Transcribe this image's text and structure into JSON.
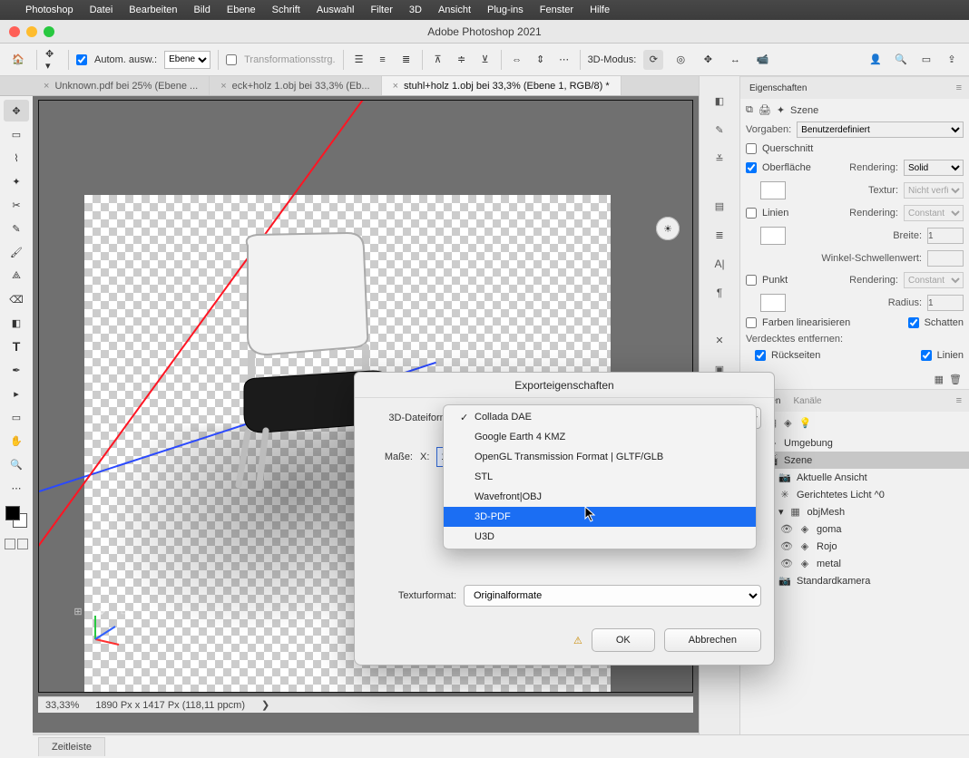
{
  "menubar": {
    "app": "Photoshop",
    "items": [
      "Datei",
      "Bearbeiten",
      "Bild",
      "Ebene",
      "Schrift",
      "Auswahl",
      "Filter",
      "3D",
      "Ansicht",
      "Plug-ins",
      "Fenster",
      "Hilfe"
    ]
  },
  "window": {
    "title": "Adobe Photoshop 2021"
  },
  "options": {
    "auto_select": "Autom. ausw.:",
    "layer_select": "Ebene",
    "transform_hint": "Transformationsstrg.",
    "mode_label": "3D-Modus:"
  },
  "tabs": [
    {
      "label": "Unknown.pdf bei 25% (Ebene ...",
      "active": false
    },
    {
      "label": "eck+holz 1.obj bei 33,3% (Eb...",
      "active": false
    },
    {
      "label": "stuhl+holz 1.obj bei 33,3% (Ebene 1, RGB/8) *",
      "active": true
    }
  ],
  "status": {
    "zoom": "33,33%",
    "dims": "1890 Px x 1417 Px (118,11 ppcm)"
  },
  "properties": {
    "title": "Eigenschaften",
    "scene_label": "Szene",
    "vorgaben_label": "Vorgaben:",
    "vorgaben_value": "Benutzerdefiniert",
    "querschnitt": "Querschnitt",
    "oberflache": "Oberfläche",
    "rendering": "Rendering:",
    "rendering_value": "Solid",
    "textur": "Textur:",
    "textur_value": "Nicht verfü...",
    "linien": "Linien",
    "linien_render": "Constant",
    "breite": "Breite:",
    "breite_value": "1",
    "winkel": "Winkel-Schwellenwert:",
    "punkt": "Punkt",
    "punkt_render": "Constant",
    "radius": "Radius:",
    "radius_value": "1",
    "linearisieren": "Farben linearisieren",
    "schatten": "Schatten",
    "verdeckt": "Verdecktes entfernen:",
    "ruckseiten": "Rückseiten",
    "linien2": "Linien"
  },
  "layers_panel": {
    "tabs": [
      "Ebenen",
      "Kanäle"
    ],
    "items": [
      {
        "label": "Umgebung",
        "icon": "◇",
        "indent": 0
      },
      {
        "label": "Szene",
        "icon": "🎬",
        "indent": 0,
        "selected": true
      },
      {
        "label": "Aktuelle Ansicht",
        "icon": "📷",
        "indent": 1
      },
      {
        "label": "Gerichtetes Licht ^0",
        "icon": "✳",
        "indent": 1
      },
      {
        "label": "objMesh",
        "icon": "▦",
        "indent": 1,
        "eye": true,
        "caret": true
      },
      {
        "label": "goma",
        "icon": "◈",
        "indent": 2
      },
      {
        "label": "Rojo",
        "icon": "◈",
        "indent": 2
      },
      {
        "label": "metal",
        "icon": "◈",
        "indent": 2
      },
      {
        "label": "Standardkamera",
        "icon": "📷",
        "indent": 1
      }
    ]
  },
  "dialog": {
    "title": "Exporteigenschaften",
    "file_format_label": "3D-Dateiformat",
    "masse_label": "Maße:",
    "x_label": "X:",
    "x_value": "1",
    "textur_label": "Texturformat:",
    "textur_value": "Originalformate",
    "ok": "OK",
    "cancel": "Abbrechen",
    "dropdown": {
      "checked": "Collada DAE",
      "options": [
        "Collada DAE",
        "Google Earth 4 KMZ",
        "OpenGL Transmission Format | GLTF/GLB",
        "STL",
        "Wavefront|OBJ",
        "3D-PDF",
        "U3D"
      ],
      "highlighted": "3D-PDF"
    }
  },
  "timeline": "Zeitleiste"
}
